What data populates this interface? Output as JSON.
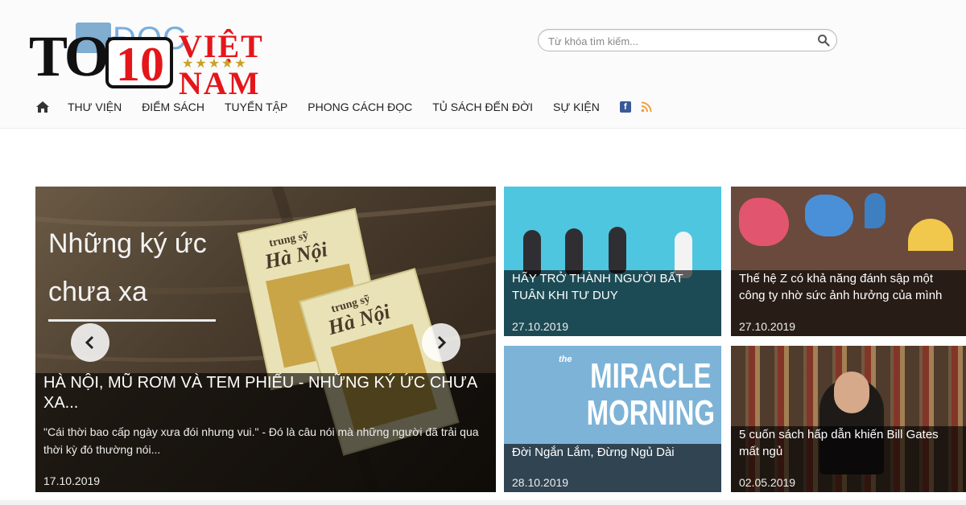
{
  "logo": {
    "underlay_text": "ĐỌC",
    "top": "TOP",
    "ten": "10",
    "viet": "VIỆT",
    "stars": "★★★★★",
    "nam": "NAM"
  },
  "search": {
    "placeholder": "Từ khóa tìm kiếm..."
  },
  "nav": {
    "items": [
      "THƯ VIỆN",
      "ĐIỂM SÁCH",
      "TUYỂN TẬP",
      "PHONG CÁCH ĐỌC",
      "TỦ SÁCH ĐẾN ĐỜI",
      "SỰ KIỆN"
    ],
    "facebook": "f"
  },
  "feature": {
    "slogan_line1": "Những ký ức",
    "slogan_line2": "chưa xa",
    "book_small": "trung sỹ",
    "book_big": "Hà Nội",
    "title": "HÀ NỘI, MŨ RƠM VÀ TEM PHIẾU - NHỮNG KÝ ỨC CHƯA XA...",
    "excerpt": "\"Cái thời bao cấp ngày xưa đói nhưng vui.\" - Đó là câu nói mà những người đã trải qua thời kỳ đó thường nói...",
    "date": "17.10.2019"
  },
  "cards": [
    {
      "title": "HÃY TRỞ THÀNH NGƯỜI BẤT TUÂN KHI TƯ DUY",
      "date": "27.10.2019"
    },
    {
      "title": "Thế hệ Z có khả năng đánh sập một công ty nhờ sức ảnh hưởng của mình",
      "date": "27.10.2019"
    },
    {
      "cover_the": "the",
      "cover_line1": "MIRACLE",
      "cover_line2": "MORNING",
      "title": "Đời Ngắn Lắm, Đừng Ngủ Dài",
      "date": "28.10.2019"
    },
    {
      "title": "5 cuốn sách hấp dẫn khiến Bill Gates mất ngủ",
      "date": "02.05.2019"
    }
  ],
  "colors": {
    "brand_red": "#e4161b",
    "facebook": "#3b5998",
    "rss": "#f0a040",
    "caption_bg": "rgba(0,0,0,0.62)"
  }
}
